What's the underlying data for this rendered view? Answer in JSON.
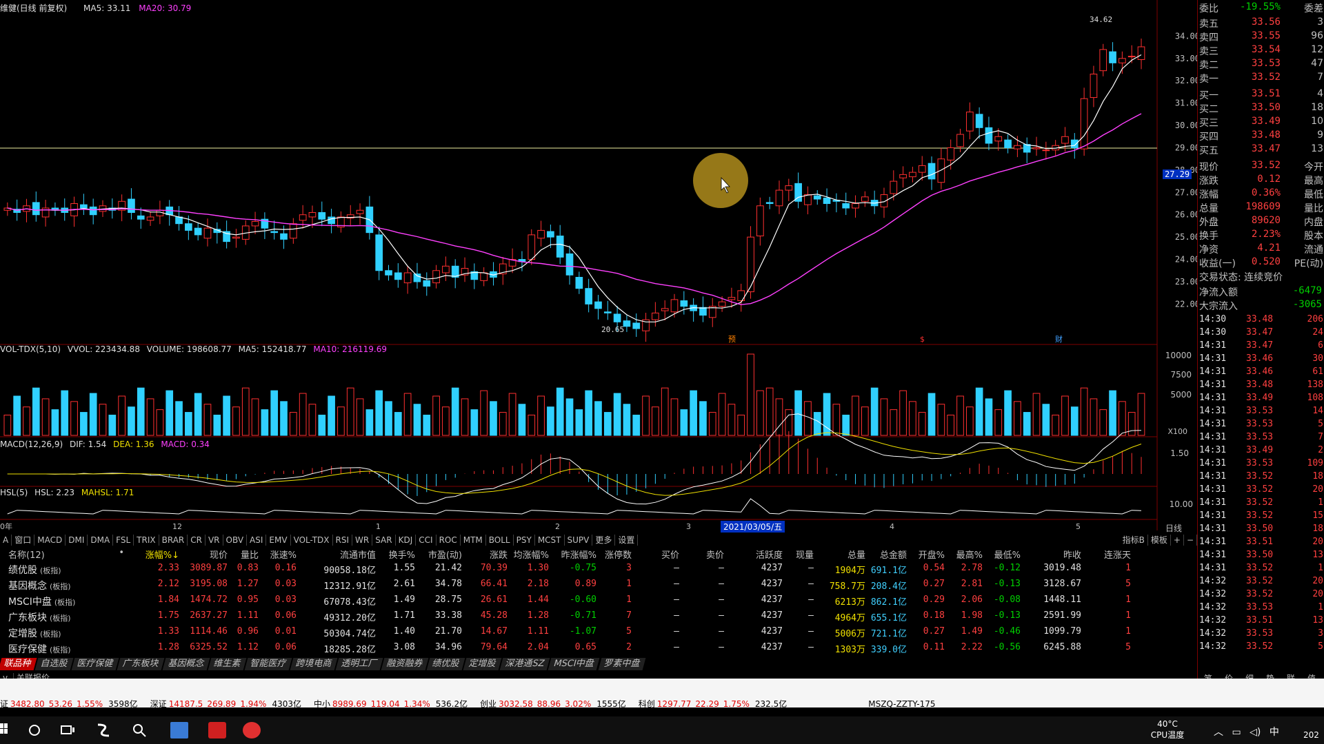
{
  "header": {
    "stock_name": "维健(日线 前复权)",
    "ma5": "MA5: 33.11",
    "ma20": "MA20: 30.79",
    "price_high_label": "34.62",
    "price_low_label": "20.65",
    "current_price_tag": "27.29"
  },
  "price_axis": [
    "34.00",
    "33.00",
    "32.00",
    "31.00",
    "30.00",
    "29.00",
    "28.00",
    "27.00",
    "26.00",
    "25.00",
    "24.00",
    "23.00",
    "22.00"
  ],
  "volume_header": {
    "name": "VOL-TDX(5,10)",
    "vvol": "VVOL: 223434.88",
    "volume": "VOLUME: 198608.77",
    "ma5": "MA5: 152418.77",
    "ma10": "MA10: 216119.69"
  },
  "volume_axis": [
    "10000",
    "7500",
    "5000",
    "X100"
  ],
  "macd_header": {
    "name": "MACD(12,26,9)",
    "dif": "DIF: 1.54",
    "dea": "DEA: 1.36",
    "macd": "MACD: 0.34"
  },
  "macd_axis": [
    "1.50"
  ],
  "hsl_header": {
    "name": "HSL(5)",
    "hsl": "HSL: 2.23",
    "mahsl": "MAHSL: 1.71"
  },
  "hsl_axis": [
    "10.00"
  ],
  "date_axis": {
    "labels": [
      "0年",
      "12",
      "1",
      "2",
      "3",
      "4",
      "5"
    ],
    "selected": "2021/03/05/五",
    "period": "日线"
  },
  "event_marks": [
    "预",
    "$",
    "财"
  ],
  "indicator_tabs": [
    "A",
    "窗口",
    "MACD",
    "DMI",
    "DMA",
    "FSL",
    "TRIX",
    "BRAR",
    "CR",
    "VR",
    "OBV",
    "ASI",
    "EMV",
    "VOL-TDX",
    "RSI",
    "WR",
    "SAR",
    "KDJ",
    "CCI",
    "ROC",
    "MTM",
    "BOLL",
    "PSY",
    "MCST",
    "SUPV",
    "更多",
    "设置"
  ],
  "right_tabs": [
    "指标B",
    "模板",
    "+",
    "−"
  ],
  "order_book": {
    "weibi_label": "委比",
    "weibi_value": "-19.55%",
    "weicha_label": "委差",
    "asks": [
      {
        "label": "卖五",
        "price": "33.56",
        "vol": "3"
      },
      {
        "label": "卖四",
        "price": "33.55",
        "vol": "96"
      },
      {
        "label": "卖三",
        "price": "33.54",
        "vol": "12"
      },
      {
        "label": "卖二",
        "price": "33.53",
        "vol": "47"
      },
      {
        "label": "卖一",
        "price": "33.52",
        "vol": "7"
      }
    ],
    "bids": [
      {
        "label": "买一",
        "price": "33.51",
        "vol": "4"
      },
      {
        "label": "买二",
        "price": "33.50",
        "vol": "18"
      },
      {
        "label": "买三",
        "price": "33.49",
        "vol": "10"
      },
      {
        "label": "买四",
        "price": "33.48",
        "vol": "9"
      },
      {
        "label": "买五",
        "price": "33.47",
        "vol": "13"
      }
    ]
  },
  "quote": [
    {
      "l": "现价",
      "v": "33.52",
      "r": "今开"
    },
    {
      "l": "涨跌",
      "v": "0.12",
      "r": "最高"
    },
    {
      "l": "涨幅",
      "v": "0.36%",
      "r": "最低"
    },
    {
      "l": "总量",
      "v": "198609",
      "r": "量比"
    },
    {
      "l": "外盘",
      "v": "89620",
      "r": "内盘"
    },
    {
      "l": "换手",
      "v": "2.23%",
      "r": "股本"
    },
    {
      "l": "净资",
      "v": "4.21",
      "r": "流通"
    },
    {
      "l": "收益(一)",
      "v": "0.520",
      "r": "PE(动)"
    }
  ],
  "trade_status": "交易状态: 连续竞价",
  "net_inflow": {
    "l": "净流入额",
    "v": "-6479"
  },
  "block_inflow": {
    "l": "大宗流入",
    "v": "-3065"
  },
  "ticks": [
    {
      "t": "14:30",
      "p": "33.48",
      "v": "206"
    },
    {
      "t": "14:30",
      "p": "33.47",
      "v": "24"
    },
    {
      "t": "14:31",
      "p": "33.47",
      "v": "6"
    },
    {
      "t": "14:31",
      "p": "33.46",
      "v": "30"
    },
    {
      "t": "14:31",
      "p": "33.46",
      "v": "61"
    },
    {
      "t": "14:31",
      "p": "33.48",
      "v": "138"
    },
    {
      "t": "14:31",
      "p": "33.49",
      "v": "108"
    },
    {
      "t": "14:31",
      "p": "33.53",
      "v": "14"
    },
    {
      "t": "14:31",
      "p": "33.53",
      "v": "5"
    },
    {
      "t": "14:31",
      "p": "33.53",
      "v": "7"
    },
    {
      "t": "14:31",
      "p": "33.49",
      "v": "2"
    },
    {
      "t": "14:31",
      "p": "33.53",
      "v": "109"
    },
    {
      "t": "14:31",
      "p": "33.52",
      "v": "18"
    },
    {
      "t": "14:31",
      "p": "33.52",
      "v": "20"
    },
    {
      "t": "14:31",
      "p": "33.52",
      "v": "1"
    },
    {
      "t": "14:31",
      "p": "33.52",
      "v": "15"
    },
    {
      "t": "14:31",
      "p": "33.50",
      "v": "18"
    },
    {
      "t": "14:31",
      "p": "33.51",
      "v": "20"
    },
    {
      "t": "14:31",
      "p": "33.50",
      "v": "13"
    },
    {
      "t": "14:31",
      "p": "33.52",
      "v": "1"
    },
    {
      "t": "14:32",
      "p": "33.52",
      "v": "20"
    },
    {
      "t": "14:32",
      "p": "33.52",
      "v": "20"
    },
    {
      "t": "14:32",
      "p": "33.53",
      "v": "1"
    },
    {
      "t": "14:32",
      "p": "33.51",
      "v": "13"
    },
    {
      "t": "14:32",
      "p": "33.53",
      "v": "3"
    },
    {
      "t": "14:32",
      "p": "33.52",
      "v": "5"
    }
  ],
  "panel_tabs": [
    "笔",
    "价",
    "细",
    "势",
    "联",
    "值"
  ],
  "table": {
    "headers": [
      "名称(12)",
      "•",
      "涨幅%↓",
      "现价",
      "量比",
      "涨速%",
      "流通市值",
      "换手%",
      "市盈(动)",
      "涨跌",
      "均涨幅%",
      "昨涨幅%",
      "涨停数",
      "买价",
      "卖价",
      "活跃度",
      "现量",
      "总量",
      "总金额",
      "开盘%",
      "最高%",
      "最低%",
      "昨收",
      "连涨天"
    ],
    "rows": [
      {
        "name": "绩优股",
        "tag": "(板指)",
        "c": [
          "2.33",
          "3089.87",
          "0.83",
          "0.16",
          "90058.18亿",
          "1.55",
          "21.42",
          "70.39",
          "1.30",
          "-0.75",
          "3",
          "—",
          "—",
          "4237",
          "—",
          "1904万",
          "691.1亿",
          "0.54",
          "2.78",
          "-0.12",
          "3019.48",
          "1"
        ]
      },
      {
        "name": "基因概念",
        "tag": "(板指)",
        "c": [
          "2.12",
          "3195.08",
          "1.27",
          "0.03",
          "12312.91亿",
          "2.61",
          "34.78",
          "66.41",
          "2.18",
          "0.89",
          "1",
          "—",
          "—",
          "4237",
          "—",
          "758.7万",
          "208.4亿",
          "0.27",
          "2.81",
          "-0.13",
          "3128.67",
          "5"
        ]
      },
      {
        "name": "MSCI中盘",
        "tag": "(板指)",
        "c": [
          "1.84",
          "1474.72",
          "0.95",
          "0.03",
          "67078.43亿",
          "1.49",
          "28.75",
          "26.61",
          "1.44",
          "-0.60",
          "1",
          "—",
          "—",
          "4237",
          "—",
          "6213万",
          "862.1亿",
          "0.29",
          "2.06",
          "-0.08",
          "1448.11",
          "1"
        ]
      },
      {
        "name": "广东板块",
        "tag": "(板指)",
        "c": [
          "1.75",
          "2637.27",
          "1.11",
          "0.06",
          "49312.20亿",
          "1.71",
          "33.38",
          "45.28",
          "1.28",
          "-0.71",
          "7",
          "—",
          "—",
          "4237",
          "—",
          "4964万",
          "655.1亿",
          "0.18",
          "1.98",
          "-0.13",
          "2591.99",
          "1"
        ]
      },
      {
        "name": "定增股",
        "tag": "(板指)",
        "c": [
          "1.33",
          "1114.46",
          "0.96",
          "0.01",
          "50304.74亿",
          "1.40",
          "21.70",
          "14.67",
          "1.11",
          "-1.07",
          "5",
          "—",
          "—",
          "4237",
          "—",
          "5006万",
          "721.1亿",
          "0.27",
          "1.49",
          "-0.46",
          "1099.79",
          "1"
        ]
      },
      {
        "name": "医疗保健",
        "tag": "(板指)",
        "c": [
          "1.28",
          "6325.52",
          "1.12",
          "0.06",
          "18285.28亿",
          "3.08",
          "34.96",
          "79.64",
          "2.04",
          "0.65",
          "2",
          "—",
          "—",
          "4237",
          "—",
          "1303万",
          "339.0亿",
          "0.11",
          "2.22",
          "-0.56",
          "6245.88",
          "5"
        ]
      }
    ]
  },
  "sector_tabs": [
    "联品种",
    "自选股",
    "医疗保健",
    "广东板块",
    "基因概念",
    "维生素",
    "智能医疗",
    "跨境电商",
    "透明工厂",
    "融资融券",
    "绩优股",
    "定增股",
    "深港通SZ",
    "MSCI中盘",
    "罗素中盘"
  ],
  "sub_tabs": [
    "v",
    "关联报价"
  ],
  "index_bar": [
    {
      "name": "证",
      "v": "3482.80",
      "c": "53.26",
      "p": "1.55%",
      "a": "3598亿"
    },
    {
      "name": "深证",
      "v": "14187.5",
      "c": "269.89",
      "p": "1.94%",
      "a": "4303亿"
    },
    {
      "name": "中小",
      "v": "8989.69",
      "c": "119.04",
      "p": "1.34%",
      "a": "536.2亿"
    },
    {
      "name": "创业",
      "v": "3032.58",
      "c": "88.96",
      "p": "3.02%",
      "a": "1555亿"
    },
    {
      "name": "科创",
      "v": "1297.77",
      "c": "22.29",
      "p": "1.75%",
      "a": "232.5亿"
    }
  ],
  "server": "MSZQ-ZZTY-175",
  "taskbar": {
    "temp": "40°C",
    "temp_label": "CPU温度",
    "ime": "中",
    "year": "202"
  },
  "chart_data": {
    "type": "candlestick",
    "price_range": [
      20.5,
      35.0
    ],
    "candles_close": [
      26.3,
      26.1,
      26.4,
      26.0,
      26.3,
      26.2,
      26.1,
      26.5,
      26.3,
      26.0,
      26.4,
      26.2,
      26.6,
      26.1,
      25.8,
      25.9,
      26.2,
      26.0,
      25.6,
      25.3,
      25.1,
      25.4,
      25.2,
      24.8,
      25.0,
      25.5,
      25.7,
      25.4,
      25.2,
      24.9,
      25.6,
      26.0,
      26.1,
      25.8,
      25.6,
      25.9,
      26.0,
      26.2,
      25.2,
      23.5,
      23.3,
      23.1,
      23.4,
      23.0,
      22.8,
      23.5,
      23.7,
      23.2,
      23.6,
      23.1,
      23.4,
      23.2,
      23.8,
      24.0,
      23.9,
      25.1,
      25.3,
      25.0,
      24.1,
      23.3,
      22.7,
      22.0,
      21.8,
      21.6,
      21.2,
      21.0,
      20.9,
      21.3,
      21.6,
      21.8,
      22.2,
      21.9,
      21.7,
      21.5,
      21.9,
      22.1,
      22.3,
      22.6,
      25.0,
      26.4,
      26.5,
      27.1,
      27.3,
      26.6,
      26.9,
      26.7,
      26.5,
      26.6,
      26.3,
      26.5,
      26.8,
      26.4,
      26.9,
      27.5,
      27.8,
      27.9,
      28.2,
      27.6,
      28.5,
      29.0,
      29.6,
      30.6,
      29.9,
      29.2,
      29.5,
      29.0,
      29.1,
      28.8,
      29.0,
      28.9,
      29.1,
      29.5,
      29.0,
      31.2,
      32.3,
      33.4,
      32.8,
      33.0,
      33.1,
      33.52
    ]
  }
}
